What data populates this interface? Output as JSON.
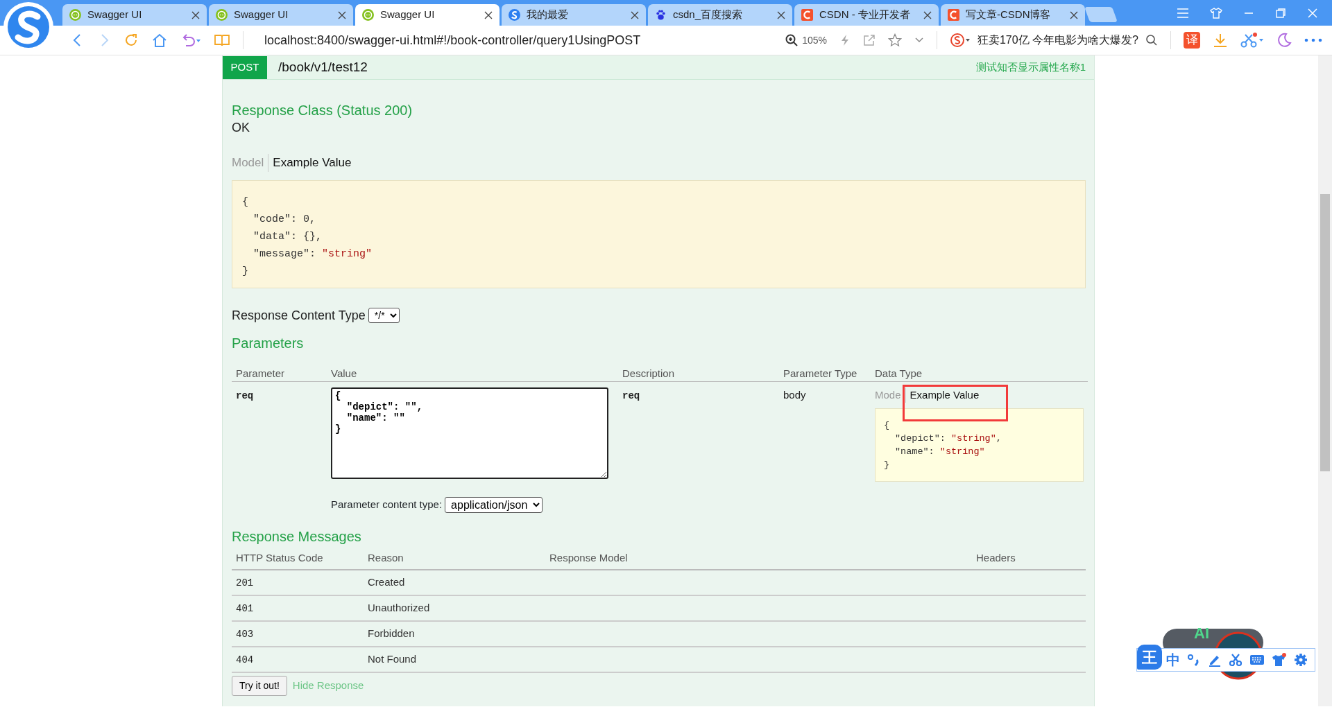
{
  "browser": {
    "tabs": [
      {
        "title": "Swagger UI",
        "kind": "swagger",
        "selected": false
      },
      {
        "title": "Swagger UI",
        "kind": "swagger",
        "selected": false
      },
      {
        "title": "Swagger UI",
        "kind": "swagger",
        "selected": true
      },
      {
        "title": "我的最爱",
        "kind": "sogou",
        "selected": false
      },
      {
        "title": "csdn_百度搜索",
        "kind": "baidu",
        "selected": false
      },
      {
        "title": "CSDN - 专业开发者",
        "kind": "csdn",
        "selected": false
      },
      {
        "title": "写文章-CSDN博客",
        "kind": "csdn",
        "selected": false
      }
    ],
    "address": "localhost:8400/swagger-ui.html#!/book-controller/query1UsingPOST",
    "zoom": "105%",
    "search_suggestion": "狂卖170亿 今年电影为啥大爆发?",
    "translate_label": "译"
  },
  "endpoint": {
    "method": "POST",
    "path": "/book/v1/test12",
    "summary": "测试知否显示属性名称1"
  },
  "response_class": {
    "title": "Response Class (Status 200)",
    "status": "OK",
    "tabs": [
      {
        "label": "Model",
        "selected": false
      },
      {
        "label": "Example Value",
        "selected": true
      }
    ],
    "example": {
      "open": "{",
      "close": "}",
      "entries": [
        {
          "key": "\"code\": ",
          "value": "0",
          "kind": "number",
          "tail": ","
        },
        {
          "key": "\"data\": ",
          "value": "{}",
          "kind": "number",
          "tail": ","
        },
        {
          "key": "\"message\": ",
          "value": "\"string\"",
          "kind": "string"
        }
      ]
    }
  },
  "response_content_type": {
    "label": "Response Content Type",
    "value": "*/*"
  },
  "parameters": {
    "title": "Parameters",
    "columns": [
      "Parameter",
      "Value",
      "Description",
      "Parameter Type",
      "Data Type"
    ],
    "rows": [
      {
        "parameter": "req",
        "value": "{\n  \"depict\": \"\",\n  \"name\": \"\"\n}",
        "description": "req",
        "parameter_type": "body",
        "data_type": {
          "tabs": [
            {
              "label": "Mode",
              "selected": false
            },
            {
              "label": "Example Value",
              "selected": true
            }
          ],
          "example": {
            "open": "{",
            "close": "}",
            "entries": [
              {
                "key": "\"depict\": ",
                "value": "\"string\"",
                "kind": "string",
                "tail": ","
              },
              {
                "key": "\"name\": ",
                "value": "\"string\"",
                "kind": "string"
              }
            ]
          }
        }
      }
    ],
    "content_type": {
      "label": "Parameter content type:",
      "value": "application/json"
    }
  },
  "response_messages": {
    "title": "Response Messages",
    "columns": [
      "HTTP Status Code",
      "Reason",
      "Response Model",
      "Headers"
    ],
    "rows": [
      {
        "code": "201",
        "reason": "Created"
      },
      {
        "code": "401",
        "reason": "Unauthorized"
      },
      {
        "code": "403",
        "reason": "Forbidden"
      },
      {
        "code": "404",
        "reason": "Not Found"
      }
    ]
  },
  "actions": {
    "try_button": "Try it out!",
    "hide_link": "Hide Response"
  },
  "ime": {
    "logo": "王",
    "mode": "中",
    "ai_label": "AI"
  }
}
